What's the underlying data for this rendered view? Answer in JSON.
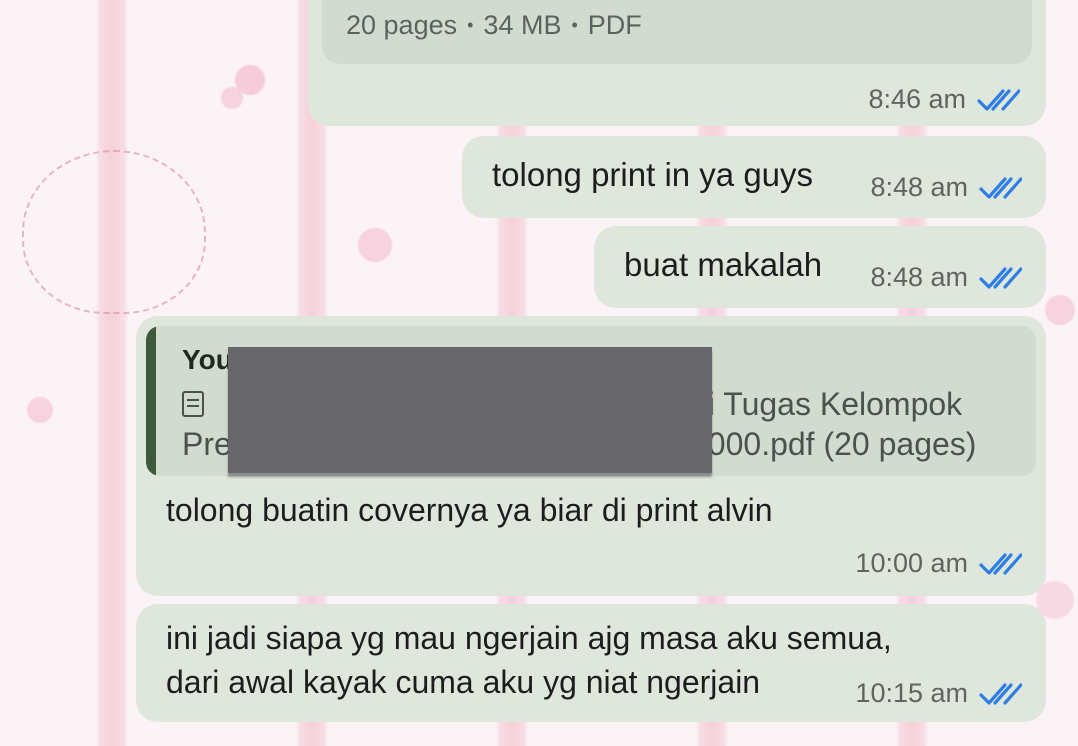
{
  "document_message": {
    "info": [
      "20 pages",
      "34 MB",
      "PDF"
    ],
    "time": "8:46 am"
  },
  "messages": [
    {
      "text": "tolong print in ya guys",
      "time": "8:48 am"
    },
    {
      "text": "buat makalah",
      "time": "8:48 am"
    }
  ],
  "reply_message": {
    "quoted": {
      "sender": "You",
      "line1_visible": "ni Tugas Kelompok",
      "line2_left": "Pre",
      "line2_right": "000.pdf (20 pages)"
    },
    "text": "tolong buatin covernya ya biar di print alvin",
    "time": "10:00 am"
  },
  "last_message": {
    "line1": "ini jadi siapa yg mau ngerjain ajg masa aku semua,",
    "line2": "dari awal kayak cuma aku yg niat ngerjain",
    "time": "10:15 am"
  },
  "icons": {
    "read_status": "double-check-icon",
    "document": "document-icon"
  },
  "colors": {
    "outgoing_bubble": "#dfe7dc",
    "read_ticks": "#2f7ee6",
    "reply_accent": "#3f5a3b"
  }
}
